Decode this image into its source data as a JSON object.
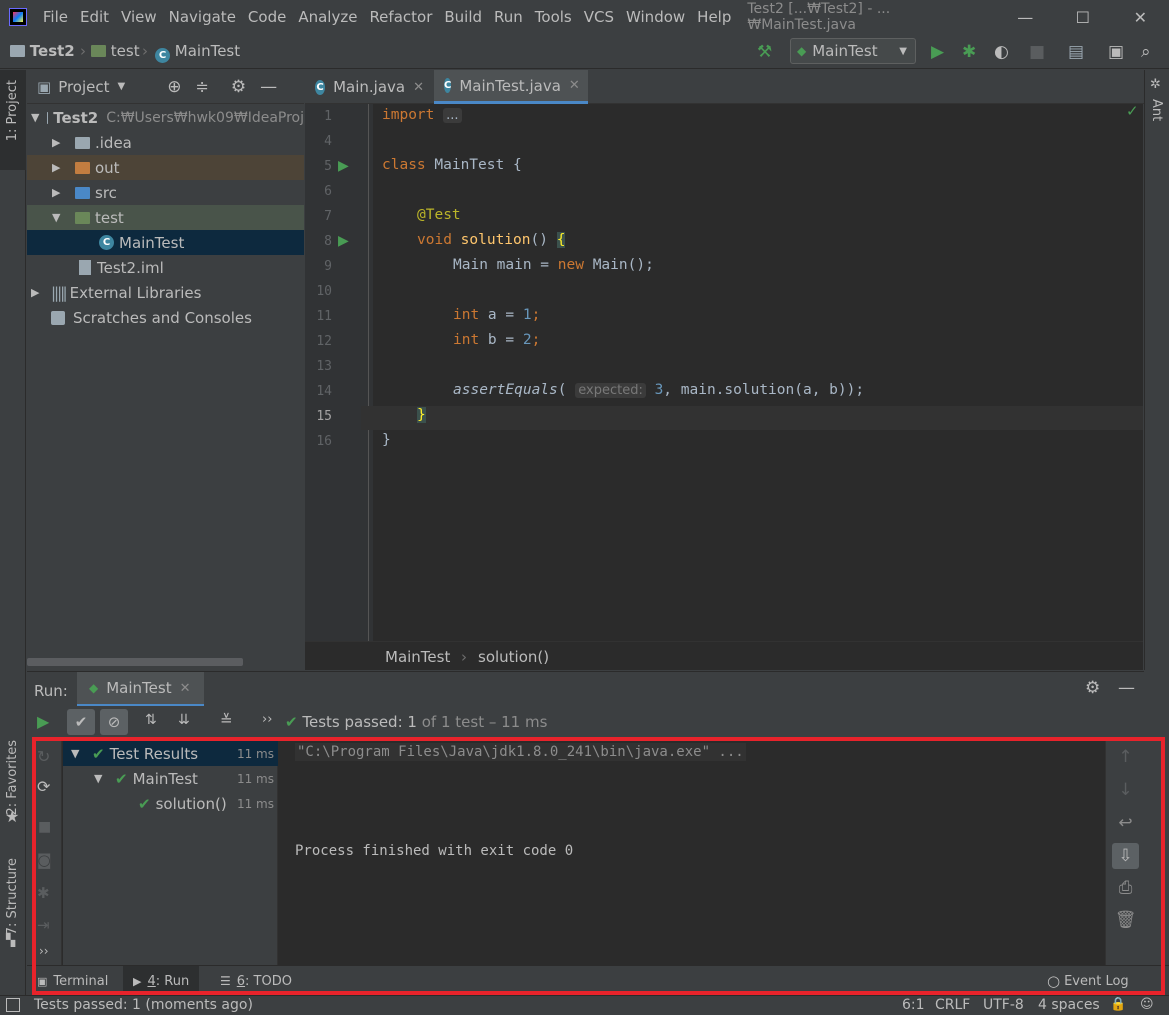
{
  "menubar": {
    "items": [
      "File",
      "Edit",
      "View",
      "Navigate",
      "Code",
      "Analyze",
      "Refactor",
      "Build",
      "Run",
      "Tools",
      "VCS",
      "Window",
      "Help"
    ],
    "title": "Test2 [...₩Test2] - ...₩MainTest.java",
    "controls": {
      "minimize": "—",
      "maximize": "☐",
      "close": "✕"
    }
  },
  "navbar": {
    "breadcrumbs": [
      "Test2",
      "test",
      "MainTest"
    ],
    "run_config": "MainTest"
  },
  "left_stripe": {
    "project": "1: Project",
    "favorites": "2: Favorites",
    "structure": "7: Structure"
  },
  "right_stripe": {
    "ant": "Ant"
  },
  "project": {
    "title": "Project",
    "root": {
      "name": "Test2",
      "path": "C:₩Users₩hwk09₩IdeaProj"
    },
    "nodes": [
      ".idea",
      "out",
      "src",
      "test",
      "MainTest",
      "Test2.iml",
      "External Libraries",
      "Scratches and Consoles"
    ]
  },
  "editor": {
    "tabs": [
      "Main.java",
      "MainTest.java"
    ],
    "line_numbers": [
      "1",
      "4",
      "5",
      "6",
      "7",
      "8",
      "9",
      "10",
      "11",
      "12",
      "13",
      "14",
      "15",
      "16"
    ],
    "code": {
      "l1_kw": "import",
      "l1_fold": "...",
      "l5_kw": "class",
      "l5_rest": " MainTest {",
      "l7": "@Test",
      "l8_kw": "void",
      "l8_fn": "solution",
      "l8_rest": "() ",
      "l8_brace": "{",
      "l9_a": "Main main = ",
      "l9_kw": "new",
      "l9_b": " Main();",
      "l11_kw": "int",
      "l11_a": " a = ",
      "l11_num": "1",
      "l11_end": ";",
      "l12_kw": "int",
      "l12_a": " b = ",
      "l12_num": "2",
      "l12_end": ";",
      "l14_fn": "assertEquals",
      "l14_open": "(",
      "l14_hint": "expected:",
      "l14_num": "3",
      "l14_rest": ", main.solution(a, b));",
      "l15": "}",
      "l16": "}"
    },
    "breadcrumb": [
      "MainTest",
      "solution()"
    ]
  },
  "run": {
    "label": "Run:",
    "tab": "MainTest",
    "status_prefix": "Tests passed:",
    "status_count": "1",
    "status_suffix": "of 1 test – 11 ms",
    "tests": [
      {
        "name": "Test Results",
        "time": "11 ms"
      },
      {
        "name": "MainTest",
        "time": "11 ms"
      },
      {
        "name": "solution()",
        "time": "11 ms"
      }
    ],
    "console": {
      "line1": "\"C:\\Program Files\\Java\\jdk1.8.0_241\\bin\\java.exe\" ...",
      "line2": "Process finished with exit code 0"
    }
  },
  "bottom_tabs": {
    "terminal": "Terminal",
    "run_num": "4",
    "run_label": ": Run",
    "todo_num": "6",
    "todo_label": ": TODO",
    "event_log": "Event Log"
  },
  "statusbar": {
    "message": "Tests passed: 1 (moments ago)",
    "position": "6:1",
    "line_sep": "CRLF",
    "encoding": "UTF-8",
    "indent": "4 spaces"
  },
  "colors": {
    "accent": "#4a88c7",
    "success": "#499c54",
    "highlight": "#e8232b"
  }
}
